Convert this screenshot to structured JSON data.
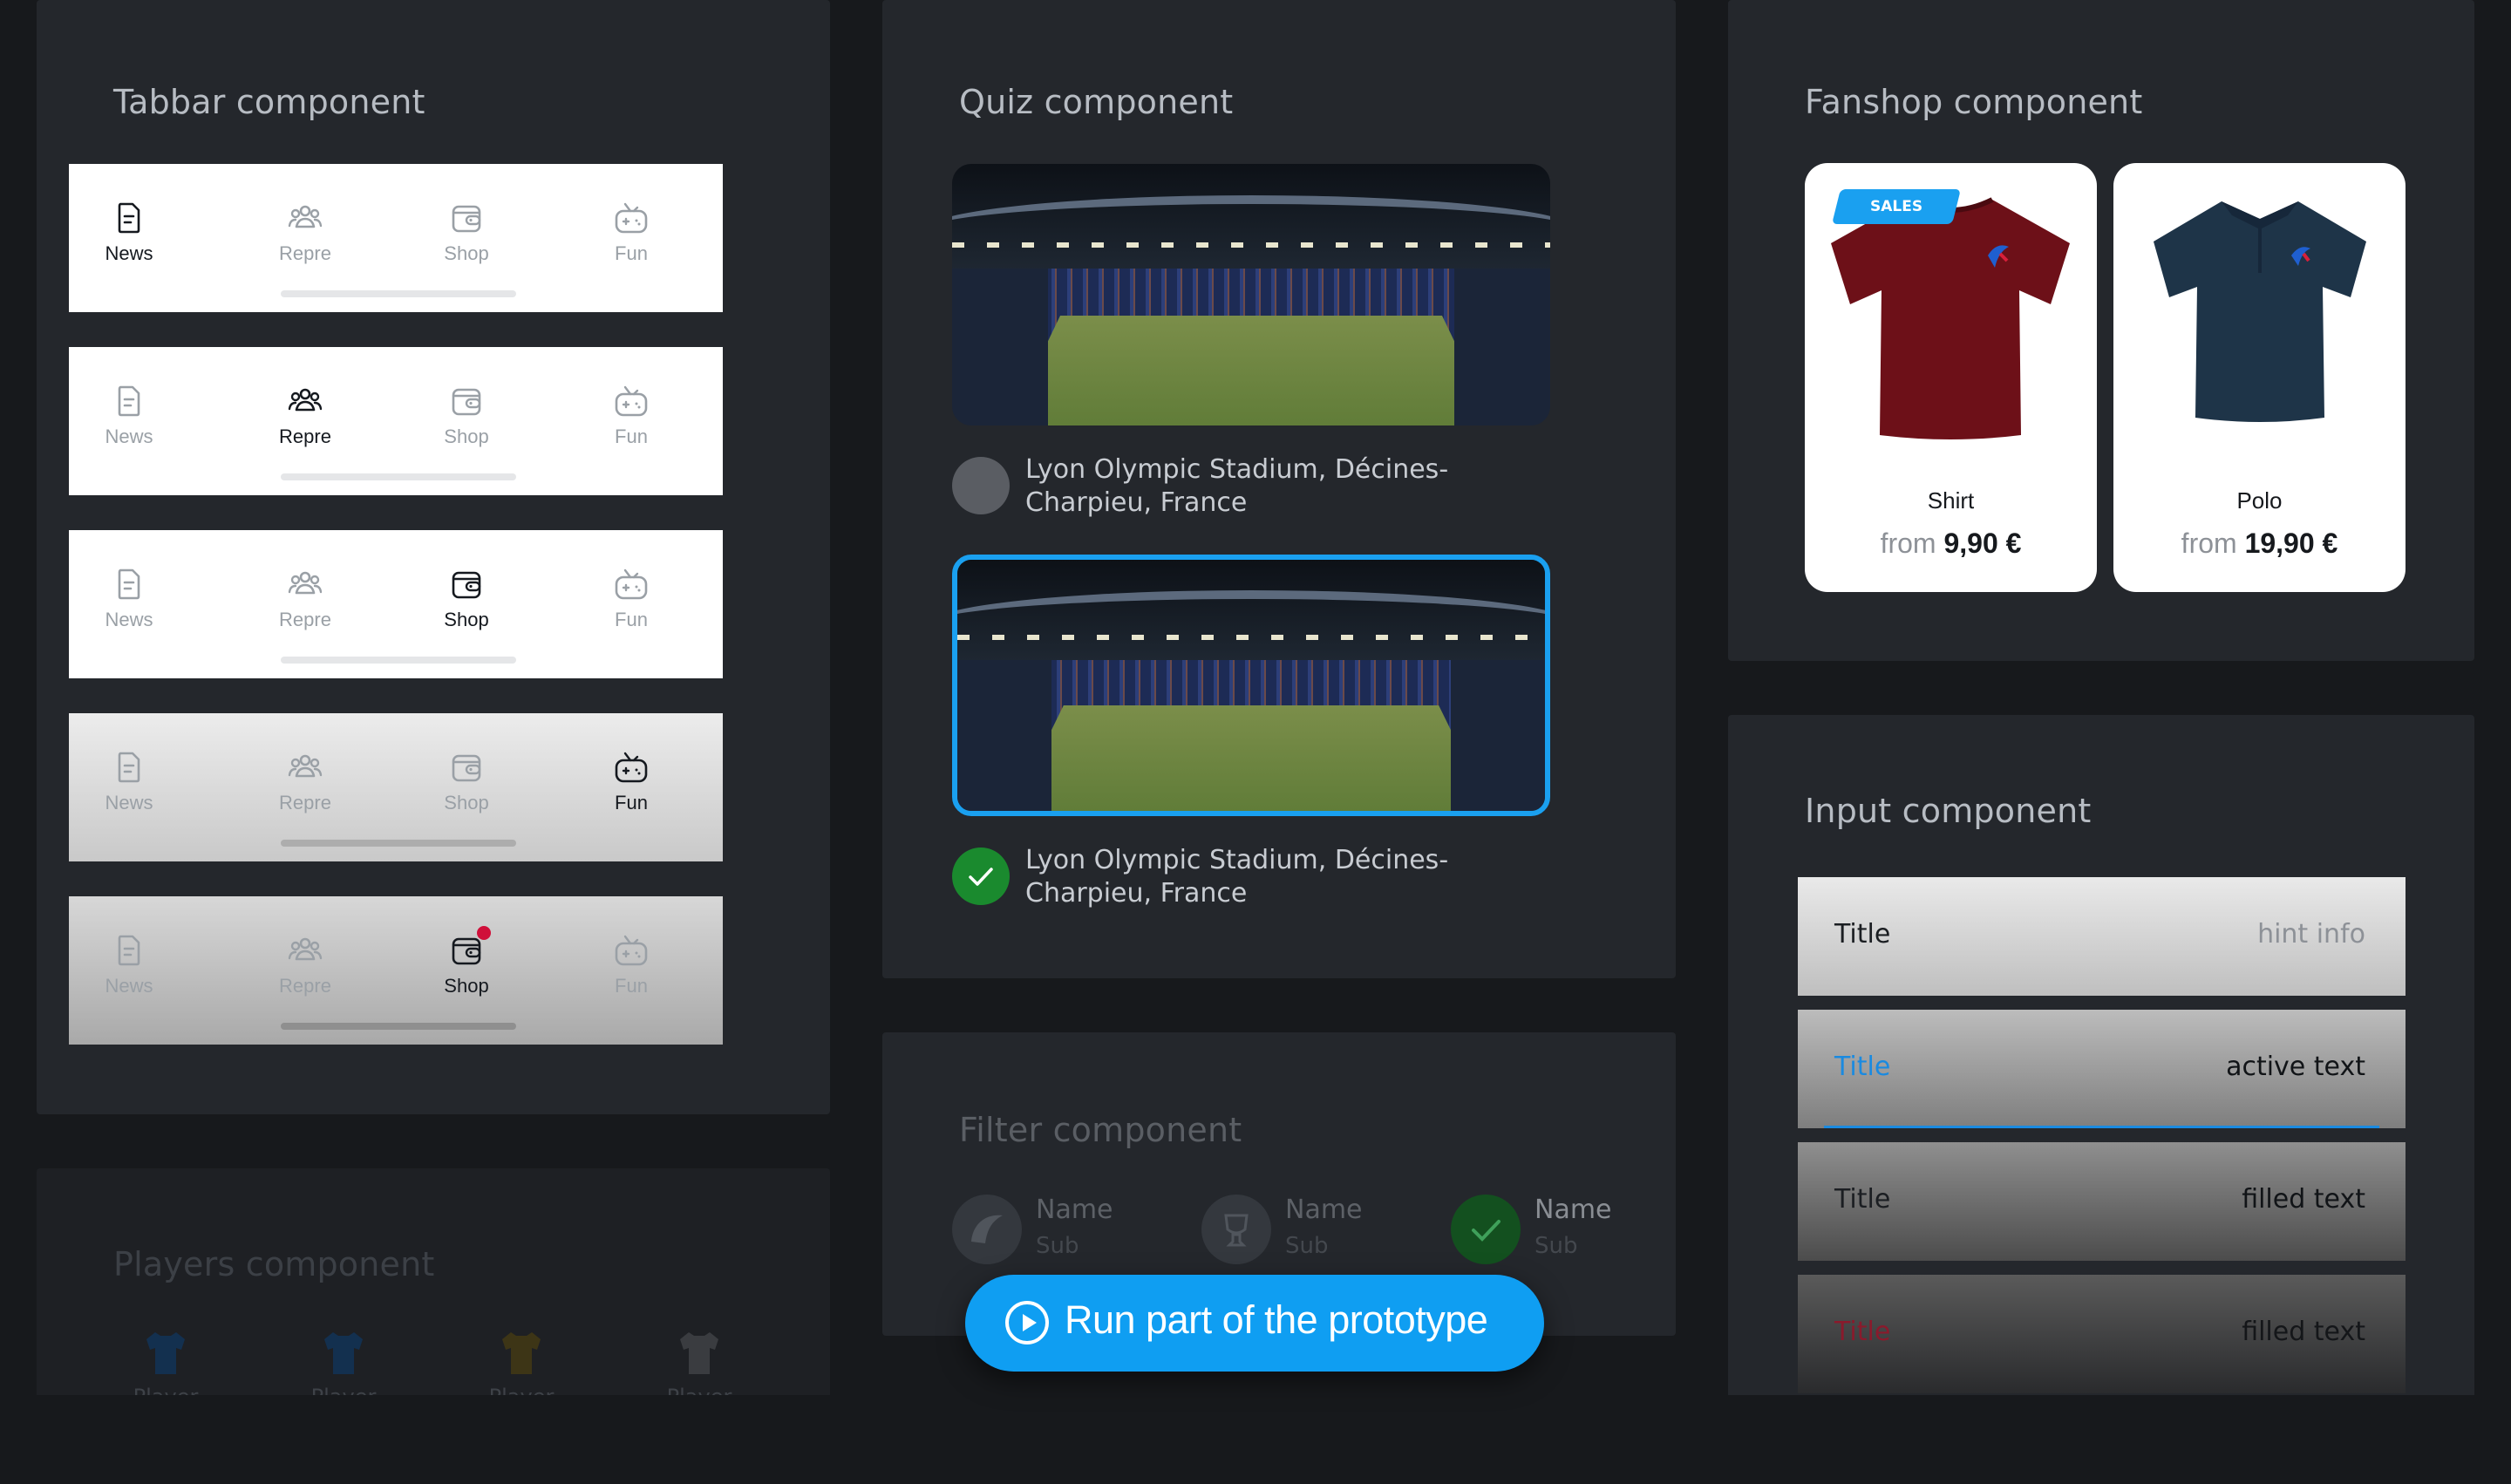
{
  "tabbar": {
    "title": "Tabbar component",
    "tabs": [
      "News",
      "Repre",
      "Shop",
      "Fun"
    ]
  },
  "quiz": {
    "title": "Quiz component",
    "option1": "Lyon Olympic Stadium, Décines-Charpieu, France",
    "option2": "Lyon Olympic Stadium, Décines-Charpieu, France",
    "correct_color": "#1a8a2e",
    "selected_border": "#1aa0f0"
  },
  "filter": {
    "title": "Filter component",
    "items": [
      {
        "name": "Name",
        "sub": "Sub"
      },
      {
        "name": "Name",
        "sub": "Sub"
      },
      {
        "name": "Name",
        "sub": "Sub"
      }
    ]
  },
  "fanshop": {
    "title": "Fanshop component",
    "badge": "SALES",
    "from_label": "from",
    "products": [
      {
        "name": "Shirt",
        "price": "9,90 €",
        "color": "#6d1018"
      },
      {
        "name": "Polo",
        "price": "19,90 €",
        "color": "#1e3448"
      }
    ]
  },
  "input": {
    "title": "Input component",
    "fields": [
      {
        "title": "Title",
        "value": "hint info"
      },
      {
        "title": "Title",
        "value": "active text"
      },
      {
        "title": "Title",
        "value": "filled text"
      },
      {
        "title": "Title",
        "value": "filled text"
      }
    ],
    "accent": "#1a8ae0",
    "error": "#b0213a"
  },
  "players": {
    "title": "Players component",
    "label": "Player"
  },
  "run_button": {
    "label": "Run part of the prototype"
  }
}
